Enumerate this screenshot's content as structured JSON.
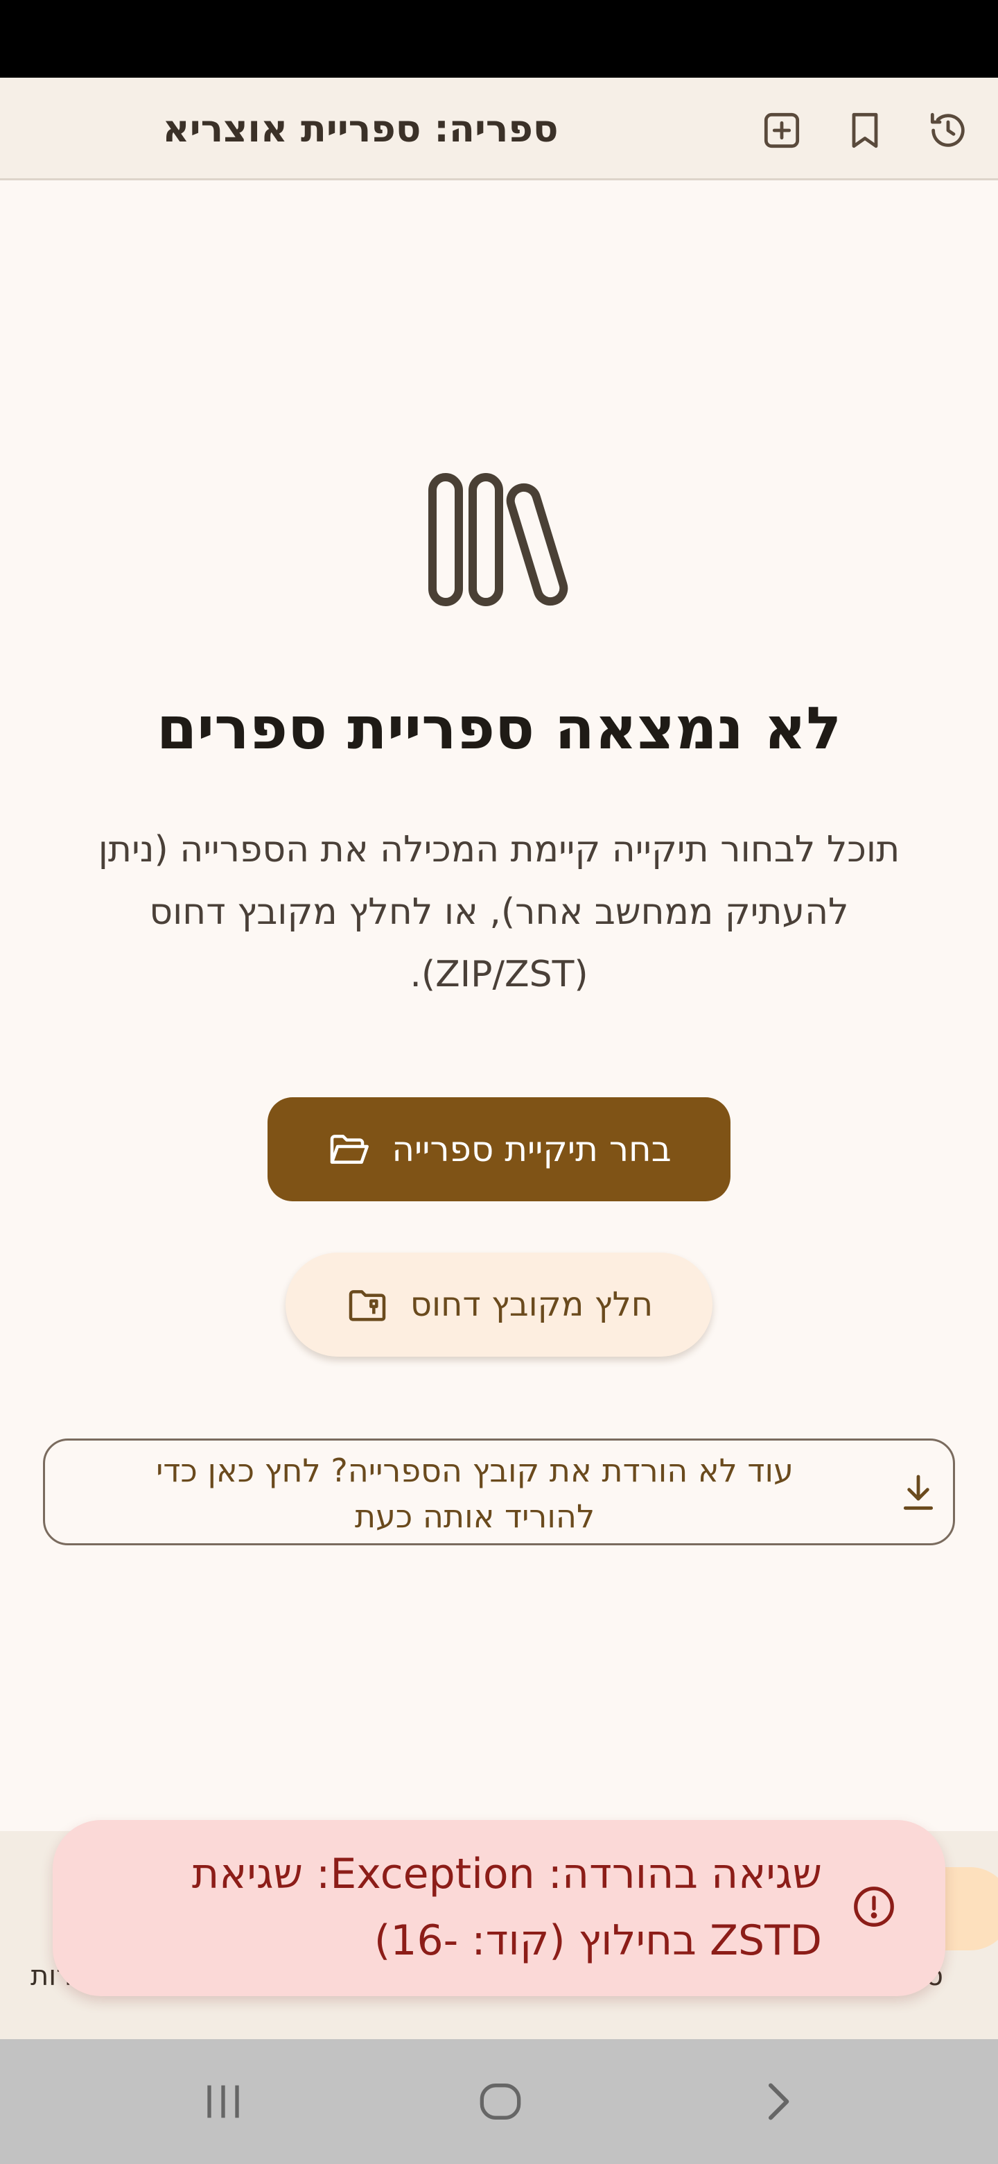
{
  "app_bar": {
    "title": "ספריה: ספריית אוצריא",
    "icons": [
      "history-icon",
      "bookmark-icon",
      "add-box-icon"
    ]
  },
  "empty_state": {
    "icon": "library-books-icon",
    "title": "לא נמצאה ספריית ספרים",
    "description": "תוכל לבחור תיקייה קיימת המכילה את הספרייה (ניתן להעתיק ממחשב אחר), או לחלץ מקובץ דחוס (ZIP/ZST)."
  },
  "buttons": {
    "choose_folder": "בחר תיקיית ספרייה",
    "extract_archive": "חלץ מקובץ דחוס",
    "download_library": "עוד לא הורדת את קובץ הספרייה? לחץ כאן כדי להוריד אותה כעת"
  },
  "bottom_nav": {
    "right_label": "ספ",
    "left_label": "רות"
  },
  "snackbar": {
    "message": "שגיאה בהורדה: Exception: שגיאת ZSTD בחילוץ (קוד: -16)",
    "icon": "error-icon"
  },
  "colors": {
    "primary": "#7f5316",
    "surface": "#fdf8f4",
    "error_container": "#fbd9d7",
    "on_error_container": "#8c1d18"
  }
}
